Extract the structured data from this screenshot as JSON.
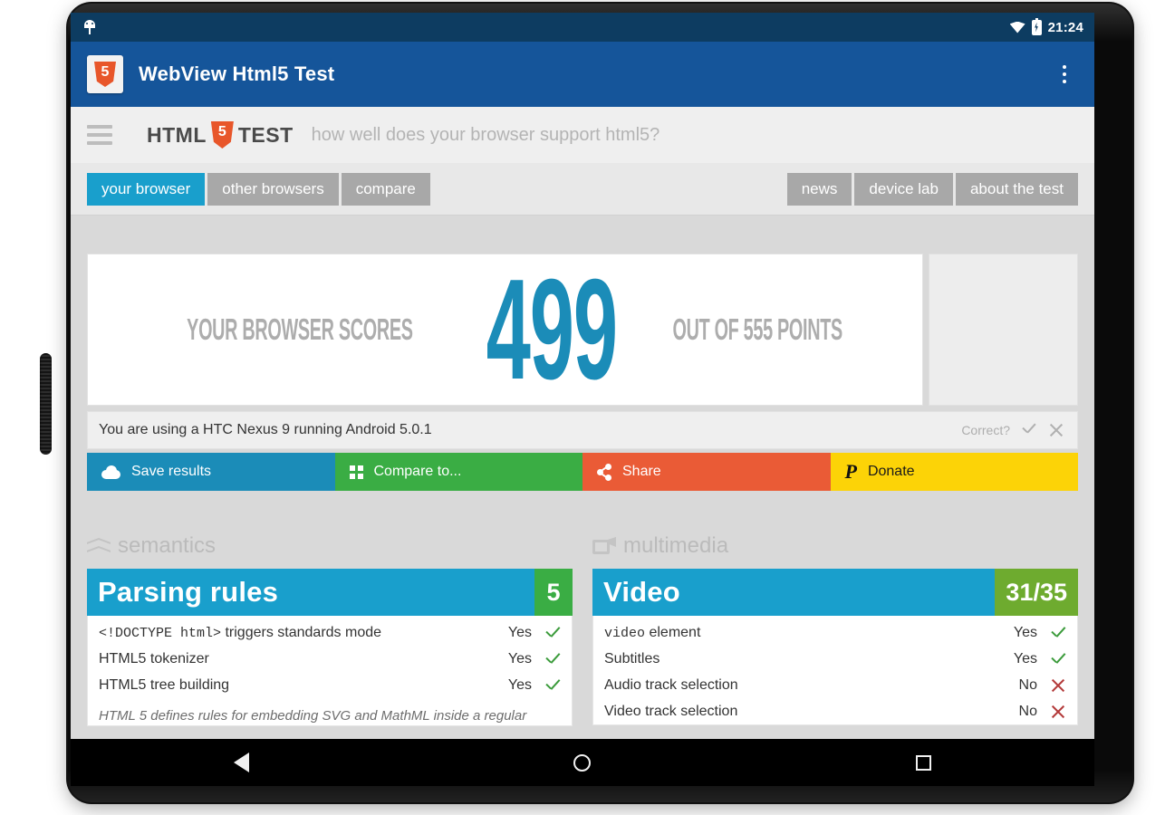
{
  "status_bar": {
    "time": "21:24",
    "icons": [
      "android-bug-icon",
      "wifi-icon",
      "battery-charging-icon"
    ]
  },
  "app_bar": {
    "title": "WebView Html5 Test",
    "logo_text": "5",
    "overflow_label": "overflow-menu"
  },
  "site_header": {
    "brand_left": "HTML",
    "brand_shield": "5",
    "brand_right": "TEST",
    "tagline": "how well does your browser support html5?"
  },
  "nav": {
    "left_tabs": [
      {
        "label": "your browser",
        "active": true
      },
      {
        "label": "other browsers",
        "active": false
      },
      {
        "label": "compare",
        "active": false
      }
    ],
    "right_tabs": [
      {
        "label": "news"
      },
      {
        "label": "device lab"
      },
      {
        "label": "about the test"
      }
    ]
  },
  "score": {
    "prefix": "YOUR BROWSER SCORES",
    "value": "499",
    "suffix": "OUT OF 555 POINTS",
    "max": "555",
    "accent_color": "#1b8cb8"
  },
  "device_bar": {
    "text": "You are using a HTC Nexus 9 running Android 5.0.1",
    "correct_label": "Correct?"
  },
  "actions": [
    {
      "label": "Save results",
      "color": "#1b8cb8",
      "icon": "cloud-upload-icon"
    },
    {
      "label": "Compare to...",
      "color": "#3aad44",
      "icon": "grid-icon"
    },
    {
      "label": "Share",
      "color": "#ea5b36",
      "icon": "share-icon"
    },
    {
      "label": "Donate",
      "color": "#fcd307",
      "icon": "paypal-icon"
    }
  ],
  "sections": [
    {
      "heading": "semantics",
      "heading_icon": "chevrons-up-icon",
      "card": {
        "title": "Parsing rules",
        "score": "5",
        "score_color": "#3aad44",
        "rows": [
          {
            "name_code": "<!DOCTYPE html>",
            "name_rest": " triggers standards mode",
            "value": "Yes",
            "mark": "yes"
          },
          {
            "name_code": "",
            "name_rest": "HTML5 tokenizer",
            "value": "Yes",
            "mark": "yes"
          },
          {
            "name_code": "",
            "name_rest": "HTML5 tree building",
            "value": "Yes",
            "mark": "yes"
          }
        ],
        "note": "HTML 5 defines rules for embedding SVG and MathML inside a regular"
      }
    },
    {
      "heading": "multimedia",
      "heading_icon": "film-camera-icon",
      "card": {
        "title": "Video",
        "score": "31/35",
        "score_color": "#6eab2f",
        "rows": [
          {
            "name_code": "video",
            "name_rest": " element",
            "value": "Yes",
            "mark": "yes"
          },
          {
            "name_code": "",
            "name_rest": "Subtitles",
            "value": "Yes",
            "mark": "yes"
          },
          {
            "name_code": "",
            "name_rest": "Audio track selection",
            "value": "No",
            "mark": "no"
          },
          {
            "name_code": "",
            "name_rest": "Video track selection",
            "value": "No",
            "mark": "no"
          }
        ],
        "note": ""
      }
    }
  ],
  "android_nav": {
    "back": "back-button",
    "home": "home-button",
    "recents": "recents-button"
  }
}
